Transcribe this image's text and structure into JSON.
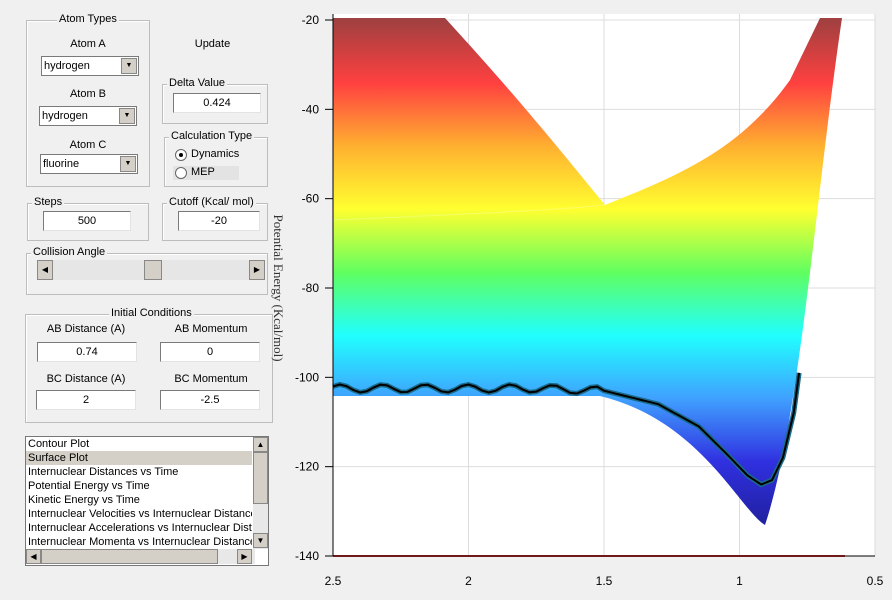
{
  "atom_types": {
    "title": "Atom Types",
    "atom_a": {
      "label": "Atom A",
      "value": "hydrogen"
    },
    "atom_b": {
      "label": "Atom B",
      "value": "hydrogen"
    },
    "atom_c": {
      "label": "Atom C",
      "value": "fluorine"
    }
  },
  "update_label": "Update",
  "delta": {
    "title": "Delta Value",
    "value": "0.424"
  },
  "calc_type": {
    "title": "Calculation Type",
    "options": [
      "Dynamics",
      "MEP"
    ],
    "selected": "Dynamics"
  },
  "steps": {
    "title": "Steps",
    "value": "500"
  },
  "cutoff": {
    "title": "Cutoff (Kcal/ mol)",
    "value": "-20"
  },
  "collision_angle": {
    "title": "Collision Angle",
    "level": 0.4
  },
  "initial": {
    "title": "Initial Conditions",
    "ab_distance": {
      "label": "AB Distance (A)",
      "value": "0.74"
    },
    "ab_momentum": {
      "label": "AB Momentum",
      "value": "0"
    },
    "bc_distance": {
      "label": "BC Distance (A)",
      "value": "2"
    },
    "bc_momentum": {
      "label": "BC Momentum",
      "value": "-2.5"
    }
  },
  "plot_list": {
    "items": [
      "Contour Plot",
      "Surface Plot",
      "Internuclear Distances vs Time",
      "Potential Energy vs Time",
      "Kinetic Energy vs Time",
      "Internuclear Velocities vs Internuclear Distance",
      "Internuclear Accelerations vs Internuclear Distance",
      "Internuclear Momenta vs Internuclear Distance"
    ],
    "selected": "Surface Plot"
  },
  "chart_data": {
    "type": "surface",
    "ylabel": "Potential Energy (Kcal/mol)",
    "xlim": [
      2.5,
      0.5
    ],
    "ylim": [
      -140,
      -20
    ],
    "x_ticks": [
      "2.5",
      "2",
      "1.5",
      "1",
      "0.5"
    ],
    "y_ticks": [
      "-20",
      "-40",
      "-60",
      "-80",
      "-100",
      "-120",
      "-140"
    ],
    "grid": true,
    "colormap": [
      "#a04040",
      "#ff4040",
      "#ffb030",
      "#ffff30",
      "#60ff60",
      "#20ffff",
      "#40a0ff",
      "#3030e0",
      "#2020a0"
    ],
    "trajectory": {
      "x": [
        2.5,
        2.25,
        2.0,
        1.75,
        1.5,
        1.3,
        1.15,
        1.05,
        0.97,
        0.92,
        0.88,
        0.84,
        0.8,
        0.78
      ],
      "y": [
        -102.5,
        -102.5,
        -102.5,
        -102.5,
        -103,
        -106,
        -111,
        -117,
        -122,
        -124,
        -123,
        -118,
        -108,
        -99
      ],
      "color": "#000000"
    }
  }
}
